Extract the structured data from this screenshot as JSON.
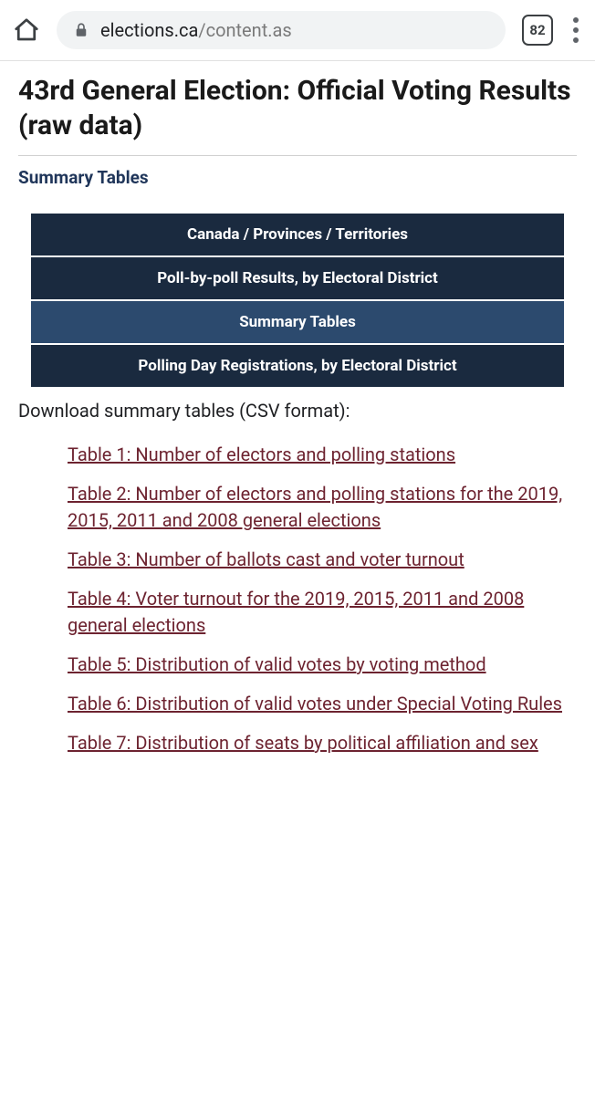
{
  "browser": {
    "url_domain": "elections.ca",
    "url_path": "/content.as",
    "tab_count": "82"
  },
  "page": {
    "title": "43rd General Election: Official Voting Results (raw data)",
    "subheading": "Summary Tables",
    "download_intro": "Download summary tables (CSV format):"
  },
  "nav": {
    "items": [
      {
        "label": "Canada / Provinces / Territories",
        "active": false
      },
      {
        "label": "Poll-by-poll Results, by Electoral District",
        "active": false
      },
      {
        "label": "Summary Tables",
        "active": true
      },
      {
        "label": "Polling Day Registrations, by Electoral District",
        "active": false
      }
    ]
  },
  "tables": [
    {
      "label": "Table 1: Number of electors and polling stations"
    },
    {
      "label": "Table 2: Number of electors and polling stations for the 2019, 2015, 2011 and 2008 general elections"
    },
    {
      "label": "Table 3: Number of ballots cast and voter turnout"
    },
    {
      "label": "Table 4: Voter turnout for the 2019, 2015, 2011 and 2008 general elections"
    },
    {
      "label": "Table 5: Distribution of valid votes by voting method"
    },
    {
      "label": "Table 6: Distribution of valid votes under Special Voting Rules"
    },
    {
      "label": "Table 7: Distribution of seats by political affiliation and sex"
    }
  ]
}
